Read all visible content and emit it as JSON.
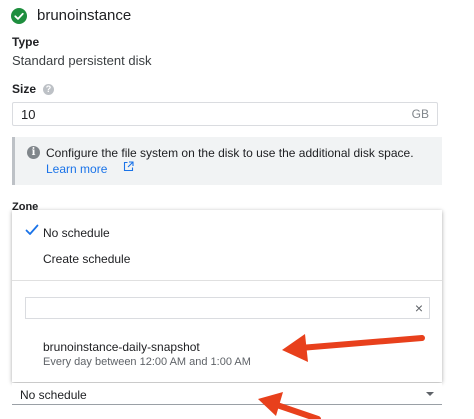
{
  "instance": {
    "name": "brunoinstance"
  },
  "type": {
    "label": "Type",
    "value": "Standard persistent disk"
  },
  "size": {
    "label": "Size",
    "help_icon": "?",
    "value": "10",
    "unit": "GB"
  },
  "info": {
    "icon": "i",
    "message": "Configure the file system on the disk to use the additional disk space.",
    "link": "Learn more"
  },
  "zone": {
    "label": "Zone"
  },
  "schedule_menu": {
    "items": [
      {
        "label": "No schedule",
        "selected": true
      },
      {
        "label": "Create schedule",
        "selected": false
      }
    ],
    "filter": {
      "value": "",
      "clear_icon": "×"
    },
    "snapshots": [
      {
        "name": "brunoinstance-daily-snapshot",
        "description": "Every day between 12:00 AM and 1:00 AM"
      }
    ]
  },
  "schedule_select": {
    "value": "No schedule"
  },
  "colors": {
    "success": "#1e8e3e",
    "link": "#1a73e8",
    "annotation_arrow": "#e8401c"
  }
}
